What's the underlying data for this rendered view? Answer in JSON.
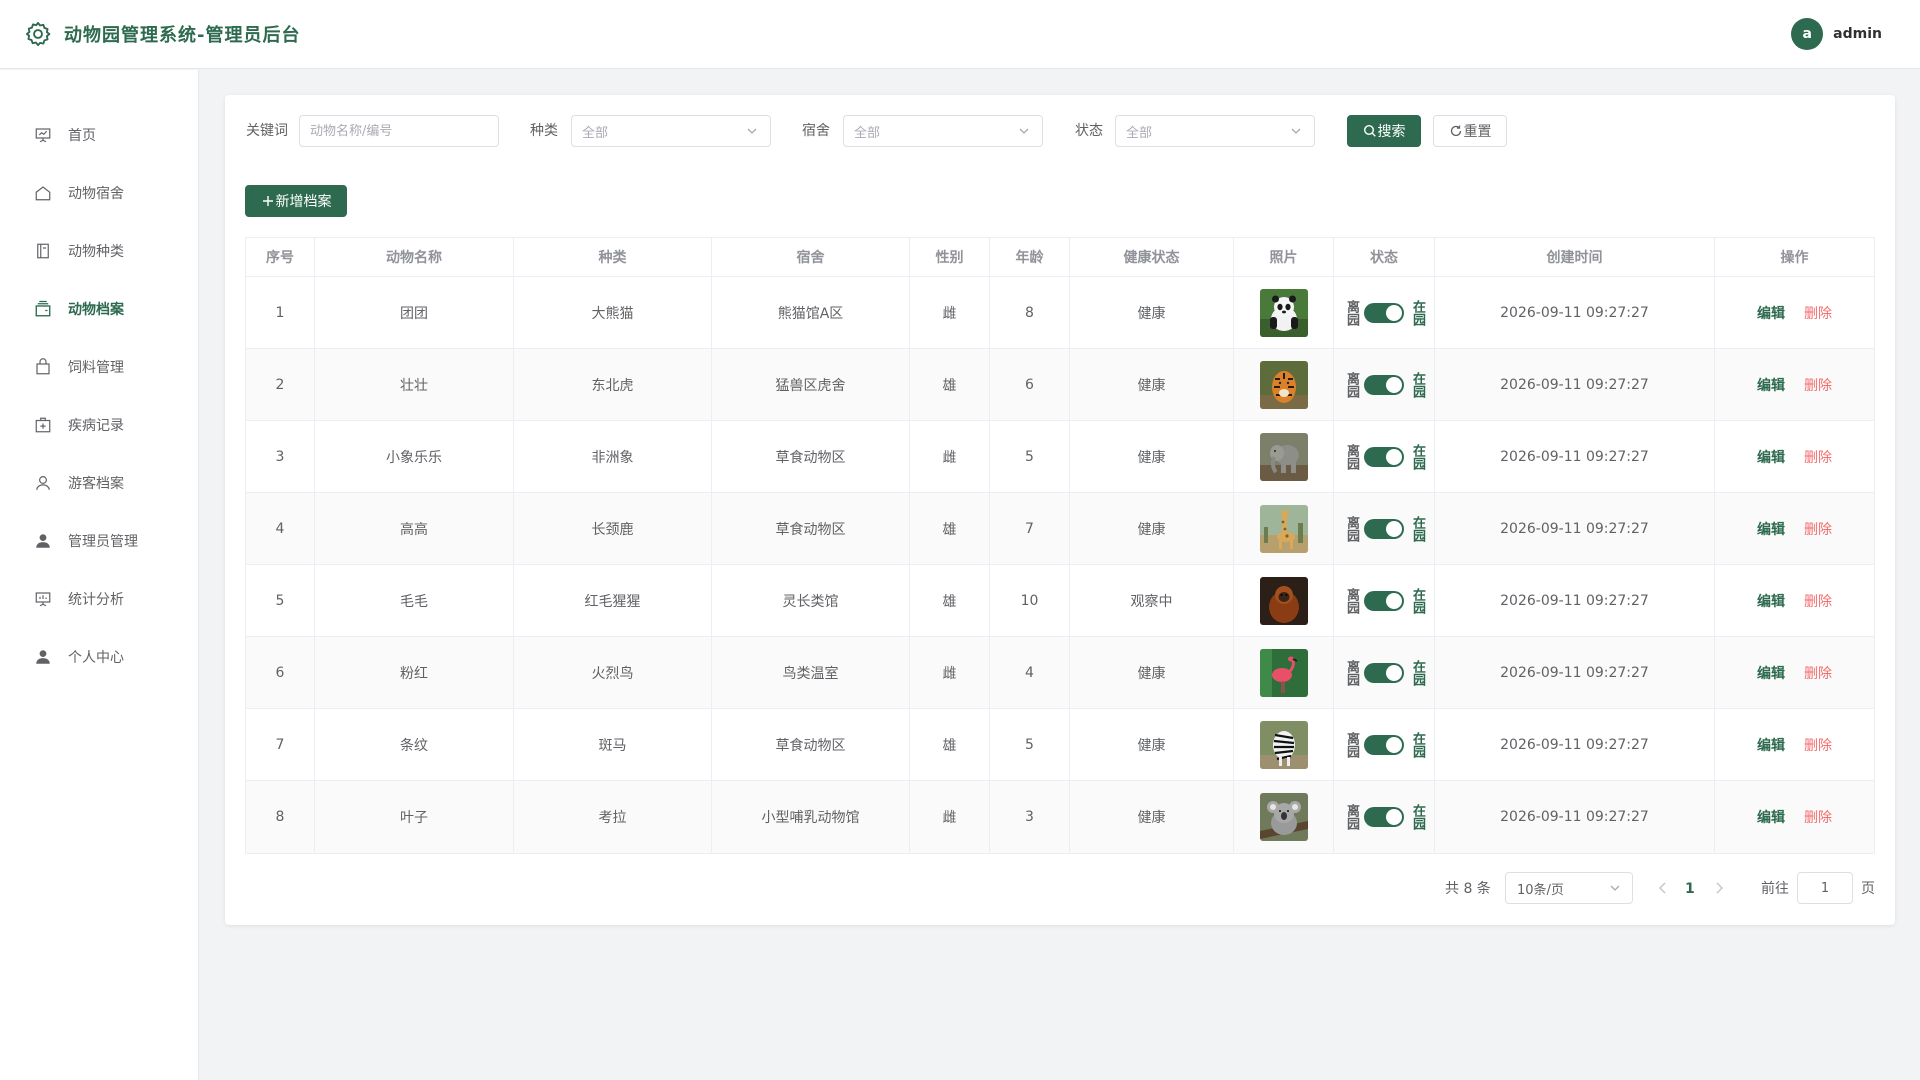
{
  "app": {
    "title": "动物园管理系统-管理员后台",
    "icon": "gear-icon",
    "accent": "#2d6a4f",
    "danger": "#f56c6c"
  },
  "user": {
    "avatar_letter": "a",
    "name": "admin"
  },
  "sidebar": {
    "items": [
      {
        "label": "首页",
        "icon": "presentation-icon",
        "active": false
      },
      {
        "label": "动物宿舍",
        "icon": "house-icon",
        "active": false
      },
      {
        "label": "动物种类",
        "icon": "notebook-icon",
        "active": false
      },
      {
        "label": "动物档案",
        "icon": "wallet-icon",
        "active": true
      },
      {
        "label": "饲料管理",
        "icon": "shopping-bag-icon",
        "active": false
      },
      {
        "label": "疾病记录",
        "icon": "first-aid-kit-icon",
        "active": false
      },
      {
        "label": "游客档案",
        "icon": "user-outline-icon",
        "active": false
      },
      {
        "label": "管理员管理",
        "icon": "user-filled-icon",
        "active": false
      },
      {
        "label": "统计分析",
        "icon": "data-board-icon",
        "active": false
      },
      {
        "label": "个人中心",
        "icon": "user-filled-icon",
        "active": false
      }
    ]
  },
  "filters": {
    "keyword_label": "关键词",
    "keyword_placeholder": "动物名称/编号",
    "species_label": "种类",
    "species_value": "全部",
    "dorm_label": "宿舍",
    "dorm_value": "全部",
    "status_label": "状态",
    "status_value": "全部",
    "search_label": "搜索",
    "reset_label": "重置"
  },
  "toolbar": {
    "add_label": "新增档案"
  },
  "table": {
    "columns": [
      "序号",
      "动物名称",
      "种类",
      "宿舍",
      "性别",
      "年龄",
      "健康状态",
      "照片",
      "状态",
      "创建时间",
      "操作"
    ],
    "switch_off_label": "离园",
    "switch_on_label": "在园",
    "edit_label": "编辑",
    "delete_label": "删除",
    "rows": [
      {
        "no": "1",
        "name": "团团",
        "species": "大熊猫",
        "dorm": "熊猫馆A区",
        "gender": "雌",
        "age": "8",
        "health": "健康",
        "photo": "giant-panda-photo",
        "status_on": true,
        "created": "2026-09-11 09:27:27"
      },
      {
        "no": "2",
        "name": "壮壮",
        "species": "东北虎",
        "dorm": "猛兽区虎舍",
        "gender": "雄",
        "age": "6",
        "health": "健康",
        "photo": "tiger-photo",
        "status_on": true,
        "created": "2026-09-11 09:27:27"
      },
      {
        "no": "3",
        "name": "小象乐乐",
        "species": "非洲象",
        "dorm": "草食动物区",
        "gender": "雌",
        "age": "5",
        "health": "健康",
        "photo": "elephant-photo",
        "status_on": true,
        "created": "2026-09-11 09:27:27"
      },
      {
        "no": "4",
        "name": "高高",
        "species": "长颈鹿",
        "dorm": "草食动物区",
        "gender": "雄",
        "age": "7",
        "health": "健康",
        "photo": "giraffe-photo",
        "status_on": true,
        "created": "2026-09-11 09:27:27"
      },
      {
        "no": "5",
        "name": "毛毛",
        "species": "红毛猩猩",
        "dorm": "灵长类馆",
        "gender": "雄",
        "age": "10",
        "health": "观察中",
        "photo": "orangutan-photo",
        "status_on": true,
        "created": "2026-09-11 09:27:27"
      },
      {
        "no": "6",
        "name": "粉红",
        "species": "火烈鸟",
        "dorm": "鸟类温室",
        "gender": "雌",
        "age": "4",
        "health": "健康",
        "photo": "flamingo-photo",
        "status_on": true,
        "created": "2026-09-11 09:27:27"
      },
      {
        "no": "7",
        "name": "条纹",
        "species": "斑马",
        "dorm": "草食动物区",
        "gender": "雄",
        "age": "5",
        "health": "健康",
        "photo": "zebra-photo",
        "status_on": true,
        "created": "2026-09-11 09:27:27"
      },
      {
        "no": "8",
        "name": "叶子",
        "species": "考拉",
        "dorm": "小型哺乳动物馆",
        "gender": "雌",
        "age": "3",
        "health": "健康",
        "photo": "koala-photo",
        "status_on": true,
        "created": "2026-09-11 09:27:27"
      }
    ]
  },
  "pagination": {
    "total_text": "共 8 条",
    "page_size": "10条/页",
    "current_page": "1",
    "goto_label": "前往",
    "goto_value": "1",
    "page_suffix": "页"
  }
}
